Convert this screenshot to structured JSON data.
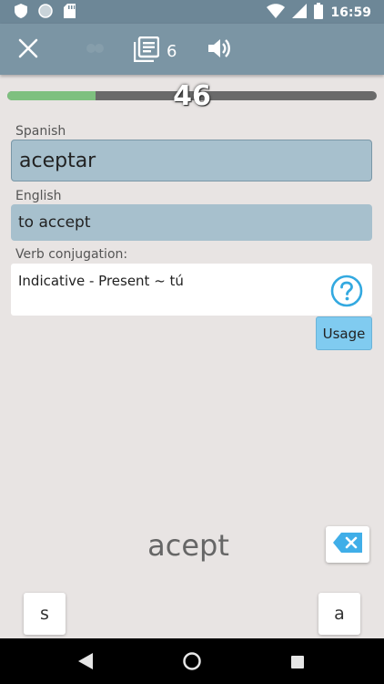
{
  "status_bar": {
    "time": "16:59",
    "left_icons": [
      "shield-icon",
      "circle-icon",
      "sd-card-icon"
    ],
    "right_icons": [
      "wifi-icon",
      "signal-icon",
      "battery-icon"
    ]
  },
  "toolbar": {
    "close_icon": "close-icon",
    "hint_icon": "hint-icon",
    "list_icon": "list-icon",
    "list_count": "6",
    "sound_icon": "volume-icon"
  },
  "progress": {
    "value": "46",
    "fraction": 0.24,
    "fill_color": "#7ec07f"
  },
  "card": {
    "spanish_label": "Spanish",
    "spanish_word": "aceptar",
    "english_label": "English",
    "english_word": "to accept",
    "conjugation_label": "Verb conjugation:",
    "conjugation_text": "Indicative - Present ~ tú",
    "help_icon": "help-icon",
    "usage_label": "Usage"
  },
  "answer": {
    "typed_text": "acept",
    "backspace_icon": "backspace-icon"
  },
  "keyboard": {
    "keys": [
      "s",
      "a"
    ]
  },
  "nav_bar": {
    "icons": [
      "back-icon",
      "home-icon",
      "recents-icon"
    ]
  },
  "colors": {
    "toolbar": "#7b95a4",
    "field": "#a7c0cd",
    "usage_button": "#80cbf0",
    "help_icon": "#33a9e0"
  }
}
